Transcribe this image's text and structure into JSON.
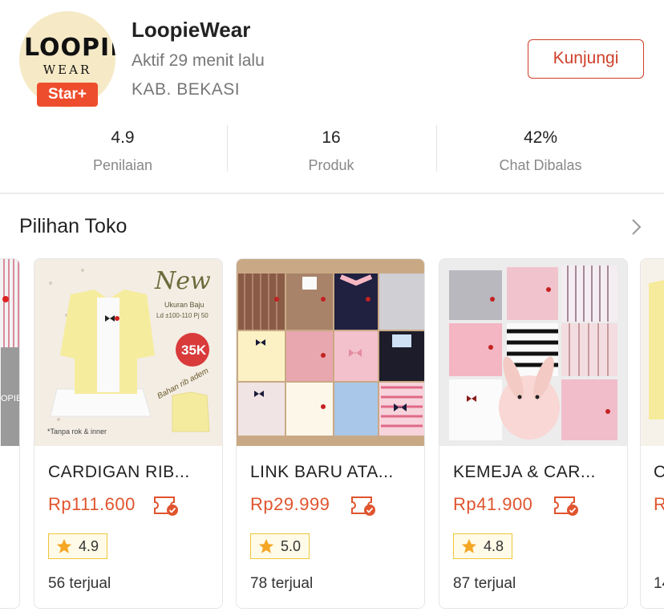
{
  "shop": {
    "logo_text": "LOOPIE",
    "logo_sub": "WEAR",
    "badge": "Star+",
    "name": "LoopieWear",
    "status": "Aktif 29 menit lalu",
    "location": "KAB. BEKASI",
    "visit_label": "Kunjungi"
  },
  "stats": [
    {
      "value": "4.9",
      "label": "Penilaian"
    },
    {
      "value": "16",
      "label": "Produk"
    },
    {
      "value": "42%",
      "label": "Chat Dibalas"
    }
  ],
  "section": {
    "title": "Pilihan Toko"
  },
  "products": [
    {
      "title": "CARDIGAN RIB...",
      "price": "Rp111.600",
      "rating": "4.9",
      "sold": "56 terjual",
      "image_text": {
        "new": "New",
        "size": "Ukuran Baju",
        "size2": "Ld ±100-110 Pj 50",
        "promo": "35K",
        "material": "Bahan rib adem",
        "note": "*Tanpa rok & inner"
      }
    },
    {
      "title": "LINK BARU ATA...",
      "price": "Rp29.999",
      "rating": "5.0",
      "sold": "78 terjual"
    },
    {
      "title": "KEMEJA & CAR...",
      "price": "Rp41.900",
      "rating": "4.8",
      "sold": "87 terjual"
    }
  ],
  "partial": {
    "left_logo": "OPIE.",
    "right_title": "C",
    "right_price": "R",
    "right_sold": "14"
  },
  "colors": {
    "accent": "#ee4d2d",
    "price": "#e0542e",
    "rating_border": "#f0c53a"
  }
}
